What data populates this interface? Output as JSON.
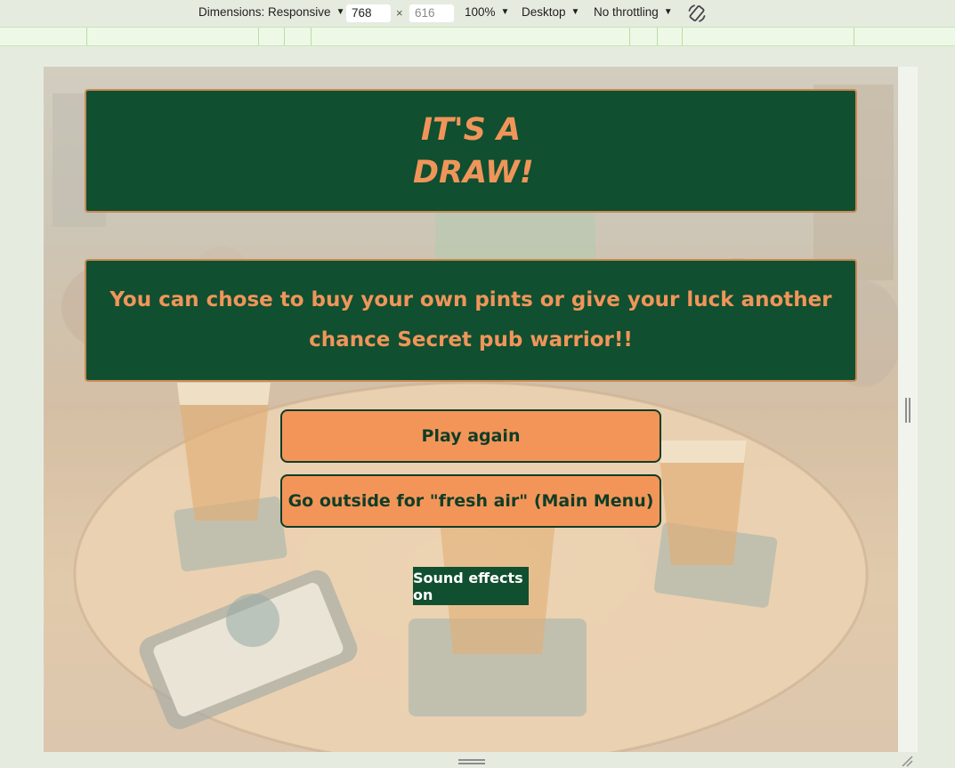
{
  "devtools": {
    "dimensions_label": "Dimensions: Responsive",
    "width_value": "768",
    "height_placeholder": "616",
    "times_symbol": "×",
    "zoom": "100%",
    "device_mode": "Desktop",
    "throttling": "No throttling",
    "icons": {
      "caret": "caret-down-icon",
      "rotate": "rotate-icon"
    }
  },
  "game": {
    "title": "IT'S A DRAW!",
    "message": "You can chose to buy your own pints or give your luck another chance Secret pub warrior!!",
    "play_again_label": "Play again",
    "main_menu_label": "Go outside for \"fresh air\" (Main Menu)",
    "sound_label": "Sound effects on"
  },
  "colors": {
    "panel_bg": "#104f30",
    "panel_text": "#f0955a",
    "button_bg": "#f39559",
    "button_text": "#103d26"
  }
}
